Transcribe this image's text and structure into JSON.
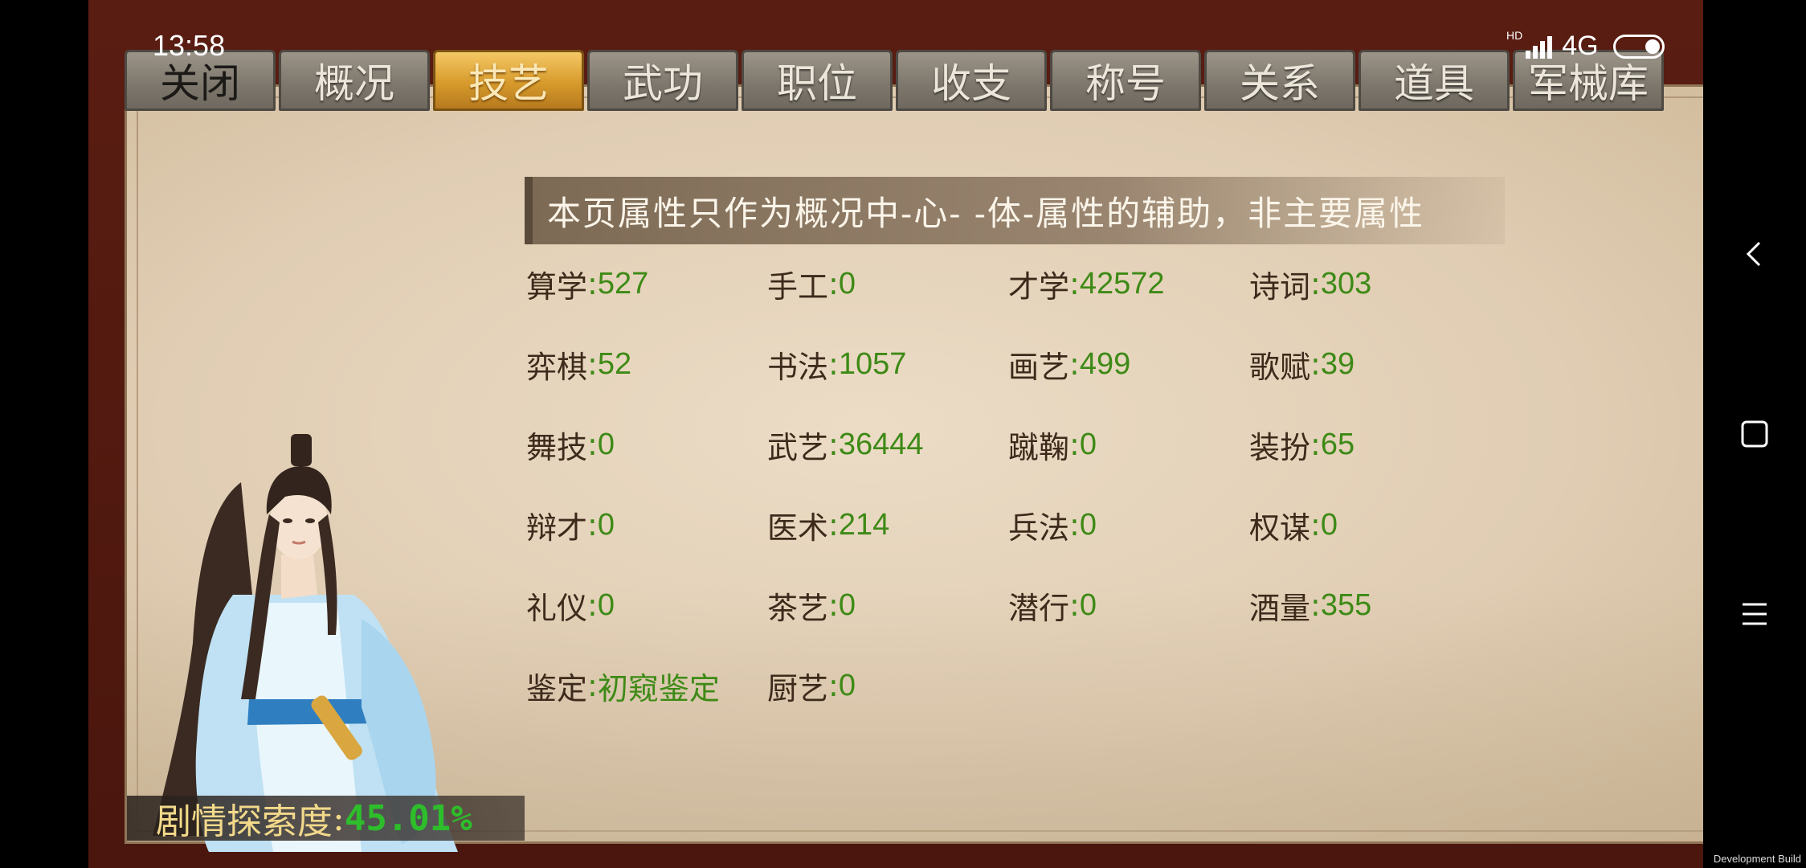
{
  "status_bar": {
    "time": "13:58",
    "hd_label": "HD",
    "network": "4G"
  },
  "tabs": [
    {
      "label": "关闭",
      "state": "close"
    },
    {
      "label": "概况",
      "state": "normal"
    },
    {
      "label": "技艺",
      "state": "active"
    },
    {
      "label": "武功",
      "state": "normal"
    },
    {
      "label": "职位",
      "state": "normal"
    },
    {
      "label": "收支",
      "state": "normal"
    },
    {
      "label": "称号",
      "state": "normal"
    },
    {
      "label": "关系",
      "state": "normal"
    },
    {
      "label": "道具",
      "state": "normal"
    },
    {
      "label": "军械库",
      "state": "normal"
    }
  ],
  "notice": "本页属性只作为概况中-心- -体-属性的辅助，非主要属性",
  "attributes": [
    {
      "name": "算学",
      "value": "527"
    },
    {
      "name": "手工",
      "value": "0"
    },
    {
      "name": "才学",
      "value": "42572"
    },
    {
      "name": "诗词",
      "value": "303"
    },
    {
      "name": "弈棋",
      "value": "52"
    },
    {
      "name": "书法",
      "value": "1057"
    },
    {
      "name": "画艺",
      "value": "499"
    },
    {
      "name": "歌赋",
      "value": "39"
    },
    {
      "name": "舞技",
      "value": "0"
    },
    {
      "name": "武艺",
      "value": "36444"
    },
    {
      "name": "蹴鞠",
      "value": "0"
    },
    {
      "name": "装扮",
      "value": "65"
    },
    {
      "name": "辩才",
      "value": "0"
    },
    {
      "name": "医术",
      "value": "214"
    },
    {
      "name": "兵法",
      "value": "0"
    },
    {
      "name": "权谋",
      "value": "0"
    },
    {
      "name": "礼仪",
      "value": "0"
    },
    {
      "name": "茶艺",
      "value": "0"
    },
    {
      "name": "潜行",
      "value": "0"
    },
    {
      "name": "酒量",
      "value": "355"
    },
    {
      "name": "鉴定",
      "value": "初窥鉴定"
    },
    {
      "name": "厨艺",
      "value": "0"
    }
  ],
  "attr_separator": ":",
  "story_progress": {
    "label": "剧情探索度",
    "value": "45.01%"
  },
  "dev_build": "Development Build",
  "colors": {
    "value_green": "#3d8a16",
    "active_tab_gold": "#d79a2b",
    "parchment": "#e0cdb3"
  },
  "icons": [
    "back-chevron-icon",
    "home-square-icon",
    "menu-lines-icon",
    "signal-icon",
    "battery-icon"
  ]
}
